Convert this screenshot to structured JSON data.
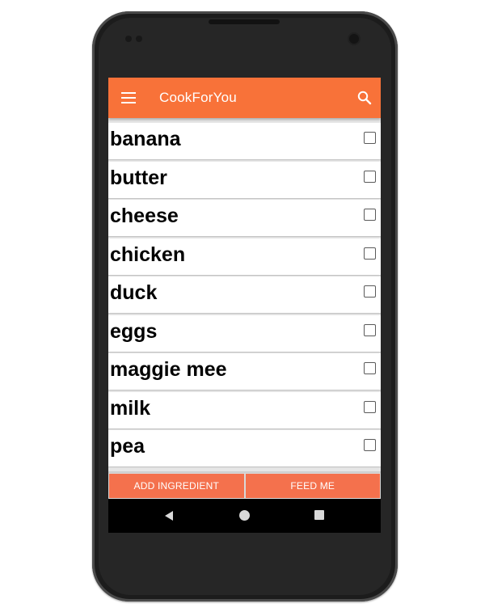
{
  "app": {
    "title": "CookForYou"
  },
  "ingredients": [
    {
      "label": "banana",
      "checked": false
    },
    {
      "label": "butter",
      "checked": false
    },
    {
      "label": "cheese",
      "checked": false
    },
    {
      "label": "chicken",
      "checked": false
    },
    {
      "label": "duck",
      "checked": false
    },
    {
      "label": "eggs",
      "checked": false
    },
    {
      "label": "maggie mee",
      "checked": false
    },
    {
      "label": "milk",
      "checked": false
    },
    {
      "label": "pea",
      "checked": false
    }
  ],
  "buttons": {
    "add_label": "ADD INGREDIENT",
    "feed_label": "FEED ME"
  },
  "colors": {
    "accent": "#f87239",
    "button": "#f4714d",
    "navbar": "#000000"
  },
  "icons": {
    "menu": "menu-icon",
    "search": "search-icon",
    "back": "back-icon",
    "home": "home-icon",
    "recents": "recents-icon"
  }
}
